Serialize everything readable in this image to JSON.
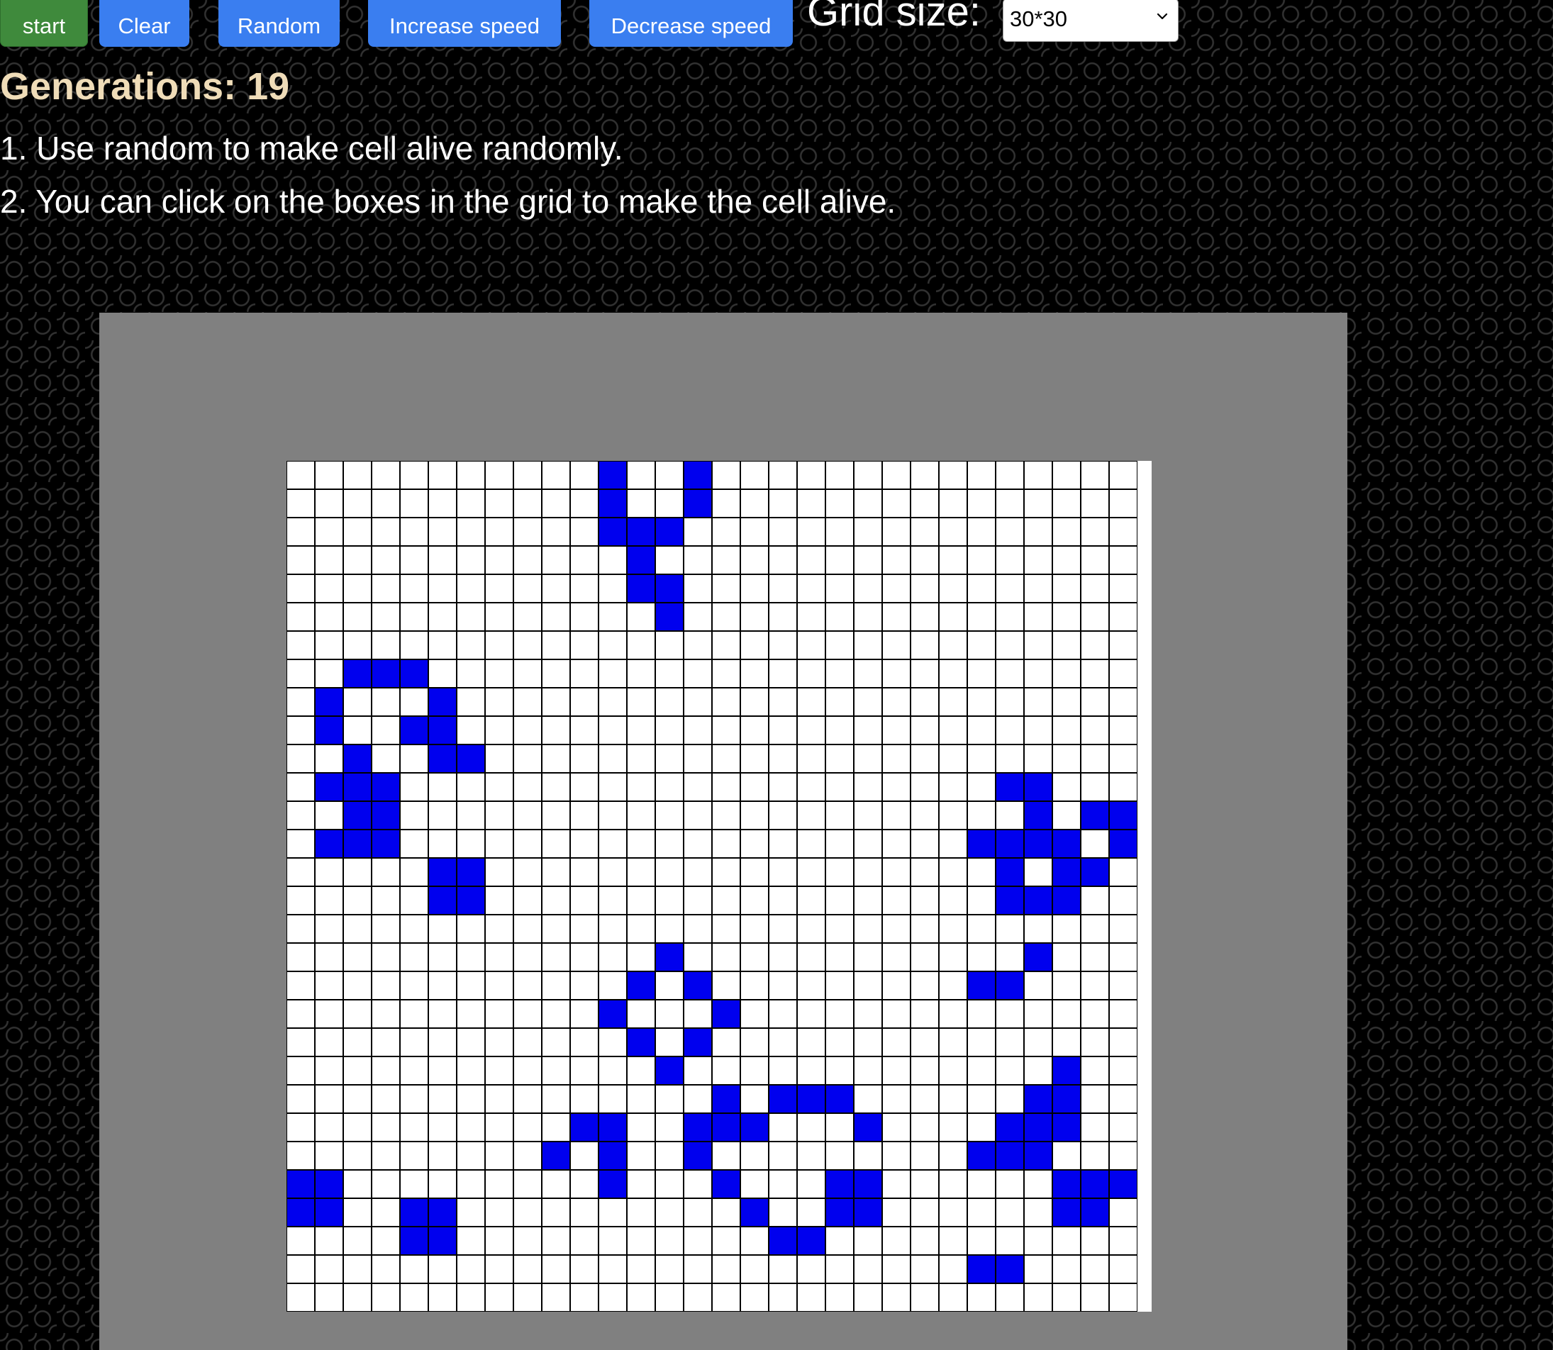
{
  "toolbar": {
    "start_label": "start",
    "clear_label": "Clear",
    "random_label": "Random",
    "increase_speed_label": "Increase speed",
    "decrease_speed_label": "Decrease speed",
    "grid_size_label": "Grid size:",
    "grid_size_value": "30*30"
  },
  "status": {
    "generations_text": "Generations: 19"
  },
  "instructions": {
    "line1": "1. Use random to make cell alive randomly.",
    "line2": "2. You can click on the boxes in the grid to make the cell alive."
  },
  "colors": {
    "start_button": "#3f8a3c",
    "action_buttons": "#3a7ef0",
    "generations_text": "#efdcb8",
    "board_frame": "#808080",
    "alive_cell": "#0000ee",
    "dead_cell": "#ffffff",
    "grid_line": "#000000"
  },
  "icons": {
    "select_chevron": "chevron-down-icon"
  },
  "grid": {
    "rows": 30,
    "cols": 30,
    "alive_cells": [
      [
        0,
        11
      ],
      [
        0,
        14
      ],
      [
        1,
        11
      ],
      [
        1,
        14
      ],
      [
        2,
        11
      ],
      [
        2,
        12
      ],
      [
        2,
        13
      ],
      [
        3,
        12
      ],
      [
        4,
        12
      ],
      [
        4,
        13
      ],
      [
        5,
        13
      ],
      [
        7,
        2
      ],
      [
        7,
        3
      ],
      [
        7,
        4
      ],
      [
        8,
        1
      ],
      [
        8,
        5
      ],
      [
        9,
        1
      ],
      [
        9,
        4
      ],
      [
        9,
        5
      ],
      [
        10,
        2
      ],
      [
        10,
        5
      ],
      [
        10,
        6
      ],
      [
        11,
        1
      ],
      [
        11,
        2
      ],
      [
        11,
        3
      ],
      [
        11,
        25
      ],
      [
        11,
        26
      ],
      [
        12,
        2
      ],
      [
        12,
        3
      ],
      [
        12,
        26
      ],
      [
        12,
        28
      ],
      [
        12,
        29
      ],
      [
        13,
        1
      ],
      [
        13,
        2
      ],
      [
        13,
        3
      ],
      [
        13,
        24
      ],
      [
        13,
        25
      ],
      [
        13,
        26
      ],
      [
        13,
        27
      ],
      [
        13,
        29
      ],
      [
        14,
        5
      ],
      [
        14,
        6
      ],
      [
        14,
        25
      ],
      [
        14,
        27
      ],
      [
        14,
        28
      ],
      [
        15,
        5
      ],
      [
        15,
        6
      ],
      [
        15,
        25
      ],
      [
        15,
        26
      ],
      [
        15,
        27
      ],
      [
        17,
        13
      ],
      [
        17,
        26
      ],
      [
        18,
        12
      ],
      [
        18,
        14
      ],
      [
        18,
        24
      ],
      [
        18,
        25
      ],
      [
        19,
        11
      ],
      [
        19,
        15
      ],
      [
        20,
        12
      ],
      [
        20,
        14
      ],
      [
        21,
        13
      ],
      [
        21,
        27
      ],
      [
        22,
        15
      ],
      [
        22,
        17
      ],
      [
        22,
        18
      ],
      [
        22,
        19
      ],
      [
        22,
        26
      ],
      [
        22,
        27
      ],
      [
        23,
        10
      ],
      [
        23,
        11
      ],
      [
        23,
        14
      ],
      [
        23,
        15
      ],
      [
        23,
        16
      ],
      [
        23,
        20
      ],
      [
        23,
        25
      ],
      [
        23,
        26
      ],
      [
        23,
        27
      ],
      [
        24,
        9
      ],
      [
        24,
        11
      ],
      [
        24,
        14
      ],
      [
        24,
        24
      ],
      [
        24,
        25
      ],
      [
        24,
        26
      ],
      [
        25,
        0
      ],
      [
        25,
        1
      ],
      [
        25,
        11
      ],
      [
        25,
        15
      ],
      [
        25,
        19
      ],
      [
        25,
        20
      ],
      [
        25,
        27
      ],
      [
        25,
        28
      ],
      [
        25,
        29
      ],
      [
        26,
        0
      ],
      [
        26,
        1
      ],
      [
        26,
        4
      ],
      [
        26,
        5
      ],
      [
        26,
        16
      ],
      [
        26,
        19
      ],
      [
        26,
        20
      ],
      [
        26,
        27
      ],
      [
        26,
        28
      ],
      [
        27,
        4
      ],
      [
        27,
        5
      ],
      [
        27,
        17
      ],
      [
        27,
        18
      ],
      [
        28,
        24
      ],
      [
        28,
        25
      ]
    ]
  }
}
